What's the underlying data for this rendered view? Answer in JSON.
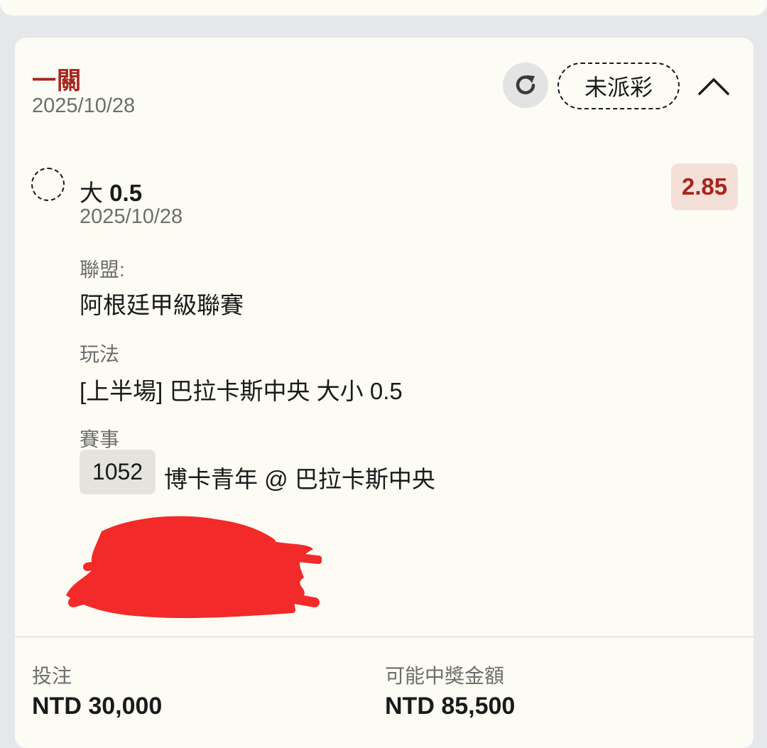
{
  "bet": {
    "type_label": "一關",
    "date": "2025/10/28",
    "status": "未派彩"
  },
  "selection": {
    "name_prefix": "大",
    "name_line": "0.5",
    "date": "2025/10/28",
    "odds": "2.85"
  },
  "details": {
    "league_label": "聯盟:",
    "league_value": "阿根廷甲級聯賽",
    "market_label": "玩法",
    "market_value": "[上半場] 巴拉卡斯中央 大小 0.5",
    "match_label": "賽事",
    "match_id": "1052",
    "match_teams": "博卡青年 @ 巴拉卡斯中央"
  },
  "summary": {
    "stake_label": "投注",
    "stake_value": "NTD 30,000",
    "payout_label": "可能中獎金額",
    "payout_value": "NTD 85,500"
  },
  "icons": {
    "refresh": "refresh-icon",
    "collapse": "chevron-up-icon"
  },
  "colors": {
    "accent": "#a5251d",
    "card_bg": "#fdfcf4",
    "page_bg": "#e6e7ea",
    "odds_bg": "#f5e0d9",
    "redaction": "#f22a2a"
  }
}
